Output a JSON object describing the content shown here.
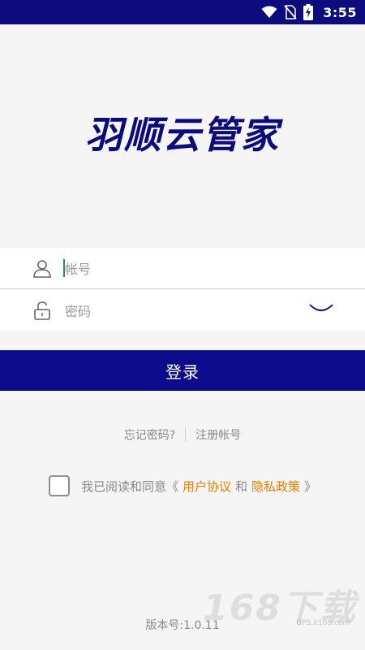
{
  "status_bar": {
    "time": "3:55",
    "icons": [
      "wifi-icon",
      "no-sim-icon",
      "battery-charging-icon"
    ],
    "background": "#0b0b7d"
  },
  "logo": {
    "text": "羽顺云管家",
    "color": "#0b0b7d"
  },
  "form": {
    "account_placeholder": "帐号",
    "password_placeholder": "密码",
    "account_icon": "user-icon",
    "password_icon": "unlock-icon",
    "toggle_icon": "eye-closed-icon"
  },
  "login_button": {
    "label": "登录",
    "color": "#0b0b8c"
  },
  "links": {
    "forgot_password": "忘记密码?",
    "register": "注册帐号"
  },
  "agreement": {
    "prefix": "我已阅读和同意《",
    "user_agreement": "用户协议",
    "and": "和",
    "privacy_policy": "隐私政策",
    "suffix": "》",
    "checked": false,
    "link_color": "#f07c00"
  },
  "version": {
    "text": "版本号:1.0.11"
  },
  "watermark": {
    "text": "168下载",
    "sub": "GPS.it168.com"
  }
}
